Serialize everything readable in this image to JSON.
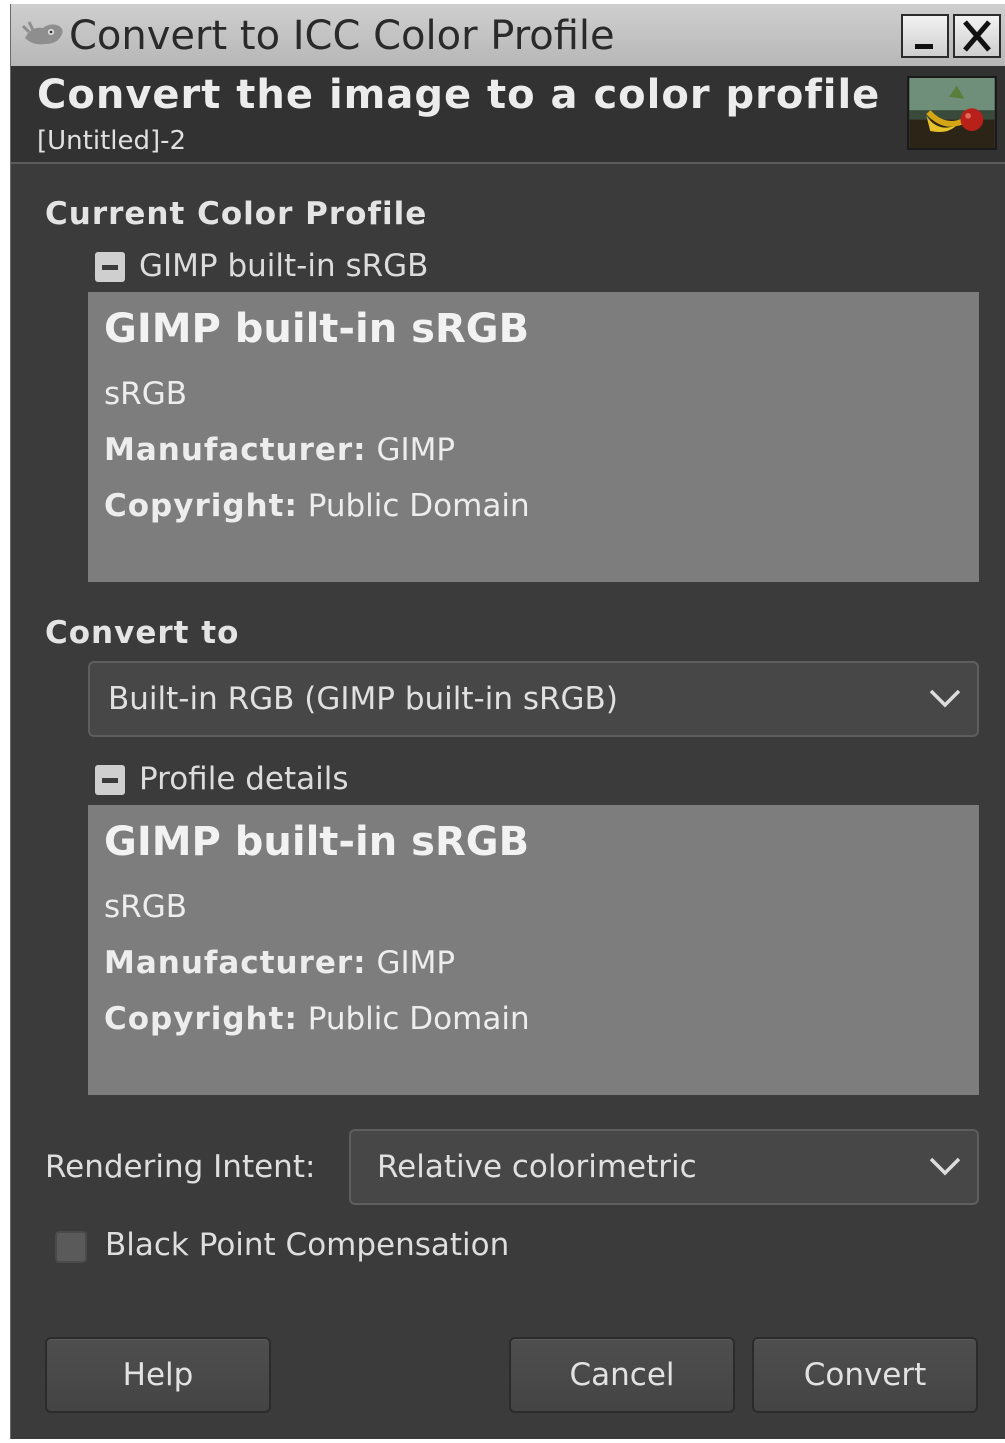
{
  "window": {
    "title": "Convert to ICC Color Profile",
    "icons": {
      "app": "gimp-wilber-icon",
      "minimize": "minimize-icon",
      "close": "close-icon"
    }
  },
  "header": {
    "title": "Convert the image to a color profile",
    "subtitle": "[Untitled]-2",
    "thumbnail": "image-thumbnail"
  },
  "current_profile": {
    "section_label": "Current Color Profile",
    "expander_label": "GIMP built-in sRGB",
    "details": {
      "name": "GIMP built-in sRGB",
      "description": "sRGB",
      "manufacturer_label": "Manufacturer:",
      "manufacturer_value": "GIMP",
      "copyright_label": "Copyright:",
      "copyright_value": "Public Domain"
    }
  },
  "convert_to": {
    "section_label": "Convert to",
    "combo_value": "Built-in RGB (GIMP built-in sRGB)",
    "expander_label": "Profile details",
    "details": {
      "name": "GIMP built-in sRGB",
      "description": "sRGB",
      "manufacturer_label": "Manufacturer:",
      "manufacturer_value": "GIMP",
      "copyright_label": "Copyright:",
      "copyright_value": "Public Domain"
    }
  },
  "rendering_intent": {
    "label": "Rendering Intent:",
    "value": "Relative colorimetric"
  },
  "black_point": {
    "label": "Black Point Compensation",
    "checked": false
  },
  "buttons": {
    "help": "Help",
    "cancel": "Cancel",
    "convert": "Convert"
  }
}
